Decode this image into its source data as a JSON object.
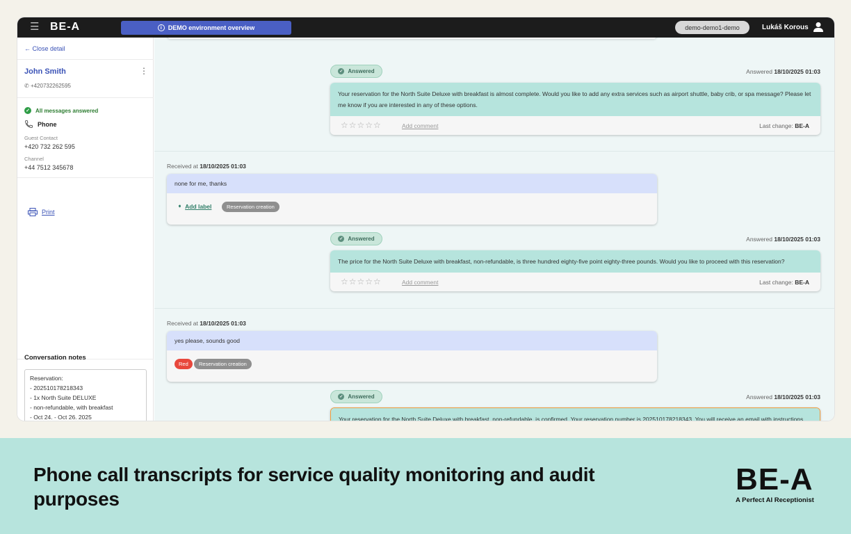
{
  "topbar": {
    "logo": "BE-A",
    "demo_banner": "DEMO environment overview",
    "env": "demo-demo1-demo",
    "user": "Lukáš Korous"
  },
  "sidebar": {
    "close_detail": "Close detail",
    "guest_name": "John Smith",
    "guest_phone_short": "+420732262595",
    "status": "All messages answered",
    "channel_type": "Phone",
    "guest_contact_label": "Guest Contact",
    "guest_contact_value": "+420 732 262 595",
    "channel_label": "Channel",
    "channel_value": "+44 7512 345678",
    "print": "Print",
    "notes_title": "Conversation notes",
    "notes_lines": [
      "Reservation:",
      "- 202510178218343",
      "- 1x North Suite DELUXE",
      "- non-refundable, with breakfast",
      "- Oct 24. - Oct 26. 2025"
    ]
  },
  "conversation": {
    "answered_label": "Answered",
    "answered_prefix": "Answered",
    "received_prefix": "Received at",
    "add_comment": "Add comment",
    "last_change_prefix": "Last change:",
    "last_change_value": "BE-A",
    "add_label": "Add label",
    "stars": "☆☆☆☆☆",
    "messages": [
      {
        "answered_time": "18/10/2025 01:03",
        "text": "Your reservation for the North Suite Deluxe with breakfast is almost complete. Would you like to add any extra services such as airport shuttle, baby crib, or spa message? Please let me know if you are interested in any of these options."
      },
      {
        "received_time": "18/10/2025 01:03",
        "guest_text": "none for me, thanks",
        "tag": "Reservation creation",
        "answered_time": "18/10/2025 01:03",
        "text": "The price for the North Suite Deluxe with breakfast, non-refundable, is three hundred eighty-five point eighty-three pounds. Would you like to proceed with this reservation?"
      },
      {
        "received_time": "18/10/2025 01:03",
        "guest_text": "yes please, sounds good",
        "tag_red": "Red",
        "tag": "Reservation creation",
        "answered_time": "18/10/2025 01:03",
        "text": "Your reservation for the North Suite Deluxe with breakfast, non-refundable, is confirmed. Your reservation number is 202510178218343. You will receive an email with instructions shortly."
      }
    ]
  },
  "footer": {
    "tagline": "Phone call transcripts for service quality monitoring and audit purposes",
    "brand": "BE-A",
    "brand_sub": "A Perfect AI Receptionist"
  },
  "colors": {
    "topbar": "#1c1c1c",
    "demo_banner": "#4a5fc4",
    "bot_bubble": "#b6e4dd",
    "guest_bubble": "#d7e0fb",
    "footer_band": "#b7e4dd",
    "tag_red": "#e8473c",
    "highlight_border": "#ef9b3d"
  }
}
